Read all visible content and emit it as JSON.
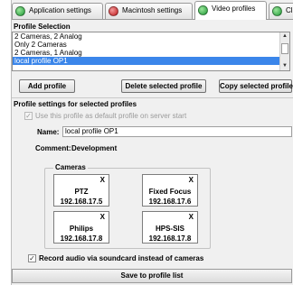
{
  "tabs": [
    {
      "label": "Application settings",
      "icon": "green-circle-icon",
      "color": "#1f9a36",
      "active": false
    },
    {
      "label": "Macintosh settings",
      "icon": "red-circle-icon",
      "color": "#c0181b",
      "active": false
    },
    {
      "label": "Video profiles",
      "icon": "green-circle-icon",
      "color": "#1f9a36",
      "active": true
    },
    {
      "label": "Client",
      "icon": "green-circle-icon",
      "color": "#1f9a36",
      "active": false
    }
  ],
  "profile_selection": {
    "title": "Profile Selection",
    "items": [
      "2 Cameras, 2 Analog",
      "Only 2 Cameras",
      "2 Cameras, 1 Analog",
      "local profile OP1"
    ],
    "selected": "local profile OP1"
  },
  "buttons": {
    "add": "Add profile",
    "delete": "Delete selected profile",
    "copy": "Copy selected profile"
  },
  "settings": {
    "title": "Profile settings for selected profiles",
    "default_checkbox_label": "Use this profile as default profile on server start",
    "default_checked": true,
    "name_label": "Name:",
    "name_value": "local profile OP1",
    "comment_label": "Comment:",
    "comment_value": "Development"
  },
  "cameras": {
    "title": "Cameras",
    "remove_symbol": "X",
    "list": [
      {
        "name": "PTZ",
        "ip": "192.168.17.5"
      },
      {
        "name": "Fixed Focus",
        "ip": "192.168.17.6"
      },
      {
        "name": "Philips",
        "ip": "192.168.17.8"
      },
      {
        "name": "HPS-SIS",
        "ip": "192.168.17.8"
      }
    ]
  },
  "audio": {
    "label": "Record audio via soundcard instead of cameras",
    "checked": true
  },
  "save_label": "Save to profile list"
}
